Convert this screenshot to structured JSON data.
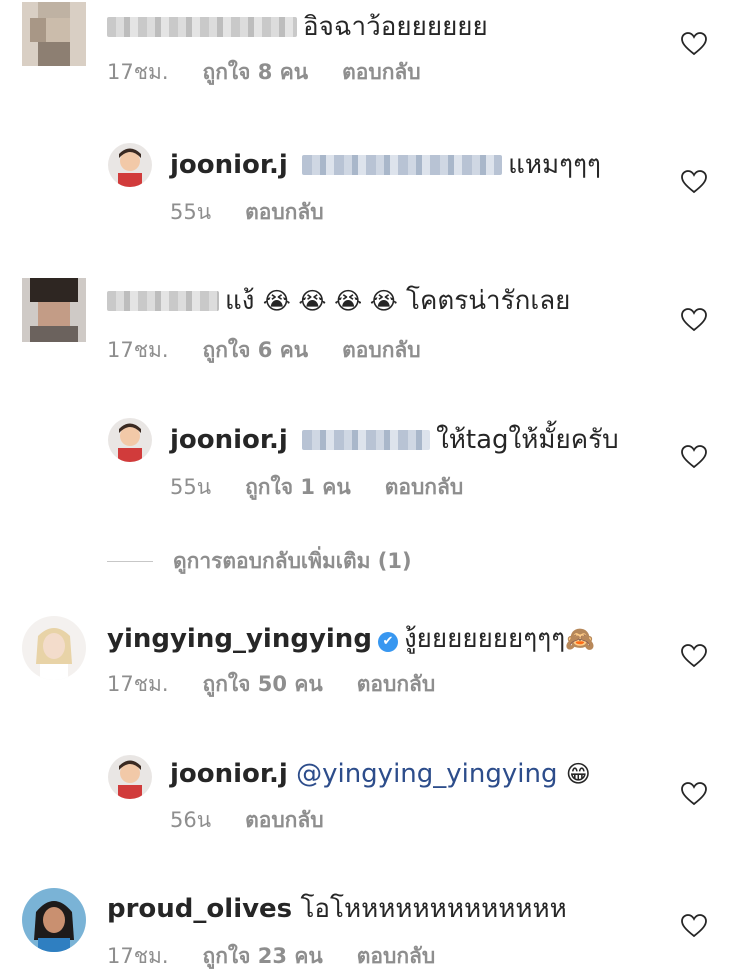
{
  "comments": [
    {
      "username": "",
      "text": "อิจฉาว้อยยยยยย",
      "time": "17ชม.",
      "likes": "ถูกใจ 8 คน",
      "reply": "ตอบกลับ",
      "icon": "heart-outline-icon"
    },
    {
      "username": "joonior.j",
      "text": "แหมๆๆๆ",
      "time": "55น",
      "likes": "",
      "reply": "ตอบกลับ",
      "icon": "heart-outline-icon"
    },
    {
      "username": "",
      "text_a": "แง้",
      "emojis": "😭 😭 😭 😭",
      "text_b": "โคตรน่ารักเลย",
      "time": "17ชม.",
      "likes": "ถูกใจ 6 คน",
      "reply": "ตอบกลับ",
      "icon": "heart-outline-icon"
    },
    {
      "username": "joonior.j",
      "text": "ให้tagให้มั้ยครับ",
      "time": "55น",
      "likes": "ถูกใจ 1 คน",
      "reply": "ตอบกลับ",
      "icon": "heart-outline-icon"
    },
    {
      "username": "yingying_yingying",
      "verified_icon": "✔",
      "text": "งู้ยยยยยยยๆๆๆ",
      "emoji": "🙈",
      "time": "17ชม.",
      "likes": "ถูกใจ 50 คน",
      "reply": "ตอบกลับ",
      "icon": "heart-outline-icon"
    },
    {
      "username": "joonior.j",
      "mention": "@yingying_yingying",
      "emoji": "😁",
      "time": "56น",
      "likes": "",
      "reply": "ตอบกลับ",
      "icon": "heart-outline-icon"
    },
    {
      "username": "proud_olives",
      "text": "โอโหหหหหหหหหหหหห",
      "time": "17ชม.",
      "likes": "ถูกใจ 23 คน",
      "reply": "ตอบกลับ",
      "icon": "heart-outline-icon"
    }
  ],
  "view_more_replies": "ดูการตอบกลับเพิ่มเติม (1)",
  "colors": {
    "text": "#262626",
    "meta": "#8e8e8e",
    "mention": "#2d4d8b",
    "verified": "#3897f0"
  }
}
